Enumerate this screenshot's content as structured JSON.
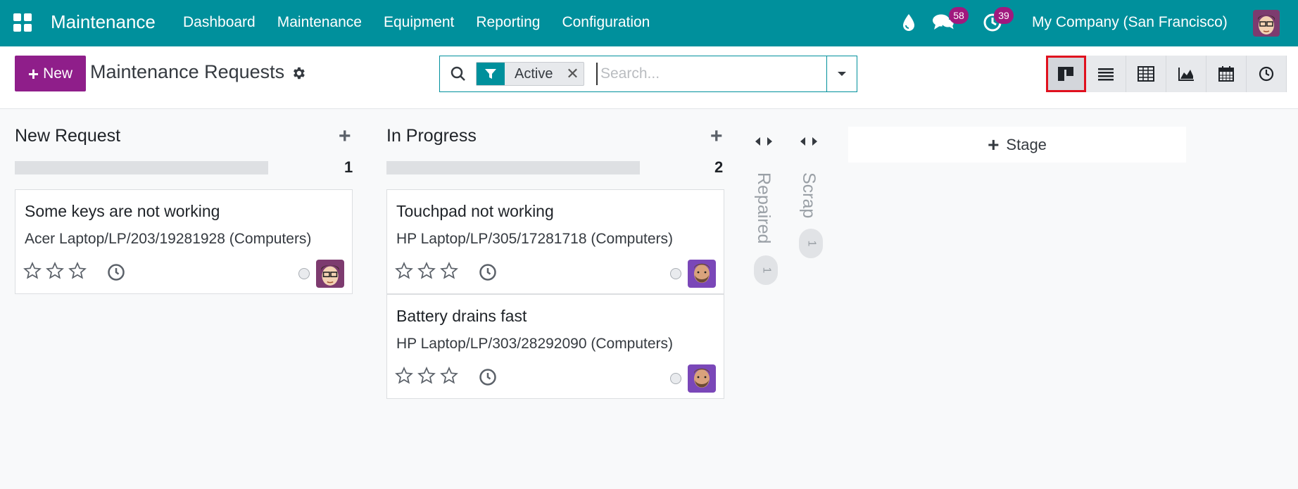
{
  "navbar": {
    "brand": "Maintenance",
    "menu": [
      "Dashboard",
      "Maintenance",
      "Equipment",
      "Reporting",
      "Configuration"
    ],
    "messages_badge": "58",
    "activities_badge": "39",
    "company": "My Company (San Francisco)"
  },
  "control": {
    "new_label": "New",
    "title": "Maintenance Requests",
    "search": {
      "facet": "Active",
      "placeholder": "Search..."
    },
    "views": [
      "kanban",
      "list",
      "pivot",
      "graph",
      "calendar",
      "activity"
    ],
    "active_view": "kanban"
  },
  "columns": [
    {
      "title": "New Request",
      "count": "1",
      "cards": [
        {
          "title": "Some keys are not working",
          "equipment": "Acer Laptop/LP/203/19281928 (Computers)",
          "priority": 0,
          "avatar": "young-man-glasses"
        }
      ]
    },
    {
      "title": "In Progress",
      "count": "2",
      "cards": [
        {
          "title": "Touchpad not working",
          "equipment": "HP Laptop/LP/305/17281718 (Computers)",
          "priority": 0,
          "avatar": "bearded-man"
        },
        {
          "title": "Battery drains fast",
          "equipment": "HP Laptop/LP/303/28292090 (Computers)",
          "priority": 0,
          "avatar": "bearded-man"
        }
      ]
    }
  ],
  "folded_columns": [
    {
      "title": "Repaired",
      "count": "1"
    },
    {
      "title": "Scrap",
      "count": "1"
    }
  ],
  "add_stage_label": "Stage",
  "colors": {
    "navbar": "#00909c",
    "primary": "#8f1e8a",
    "badge": "#a0197e",
    "highlight": "#e0101e"
  }
}
